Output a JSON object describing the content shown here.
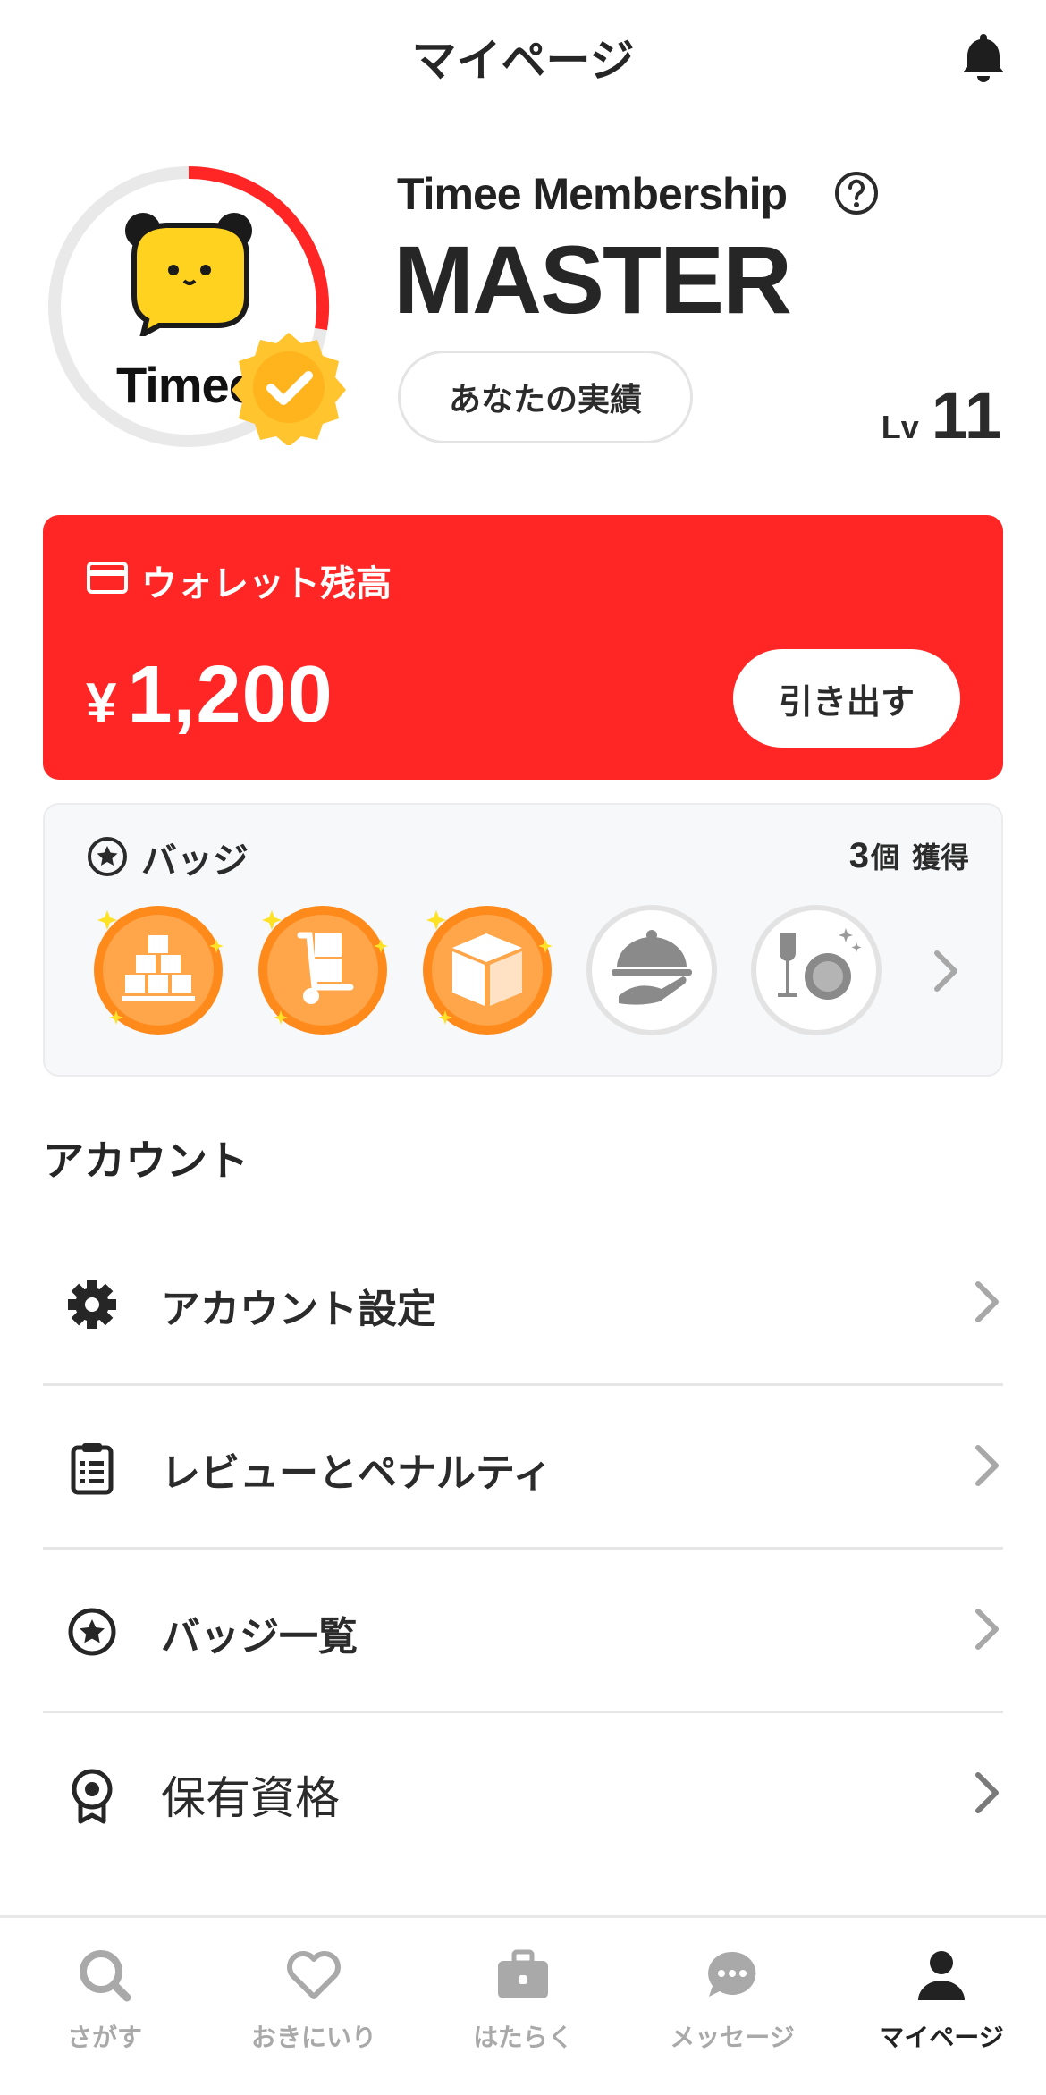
{
  "header": {
    "title": "マイページ"
  },
  "profile": {
    "logo_text": "Timee",
    "membership_label": "Timee Membership",
    "rank": "MASTER",
    "achievements_button": "あなたの実績",
    "level_label": "Lv",
    "level_value": "11",
    "level_progress": 0.4
  },
  "wallet": {
    "title": "ウォレット残高",
    "currency_symbol": "¥",
    "amount": "1,200",
    "withdraw_button": "引き出す",
    "color": "#ff2625"
  },
  "badges": {
    "title": "バッジ",
    "count": "3",
    "count_unit": "個",
    "count_suffix": "獲得",
    "items": [
      {
        "icon": "boxes-stack-badge-icon",
        "earned": true
      },
      {
        "icon": "hand-truck-badge-icon",
        "earned": true
      },
      {
        "icon": "cardboard-box-badge-icon",
        "earned": true
      },
      {
        "icon": "food-cloche-badge-icon",
        "earned": false
      },
      {
        "icon": "wine-dish-badge-icon",
        "earned": false
      }
    ]
  },
  "account": {
    "section_title": "アカウント",
    "items": [
      {
        "label": "アカウント設定",
        "icon": "gear-icon"
      },
      {
        "label": "レビューとペナルティ",
        "icon": "clipboard-icon"
      },
      {
        "label": "バッジ一覧",
        "icon": "star-circle-icon"
      },
      {
        "label": "保有資格",
        "icon": "award-ribbon-icon"
      }
    ]
  },
  "tabs": [
    {
      "label": "さがす",
      "icon": "search-icon",
      "active": false
    },
    {
      "label": "おきにいり",
      "icon": "heart-icon",
      "active": false
    },
    {
      "label": "はたらく",
      "icon": "briefcase-icon",
      "active": false
    },
    {
      "label": "メッセージ",
      "icon": "chat-bubble-icon",
      "active": false
    },
    {
      "label": "マイページ",
      "icon": "person-icon",
      "active": true
    }
  ],
  "colors": {
    "accent": "#ff2625",
    "badge_orange": "#ff9a2e",
    "inactive": "#a9a9a9"
  }
}
